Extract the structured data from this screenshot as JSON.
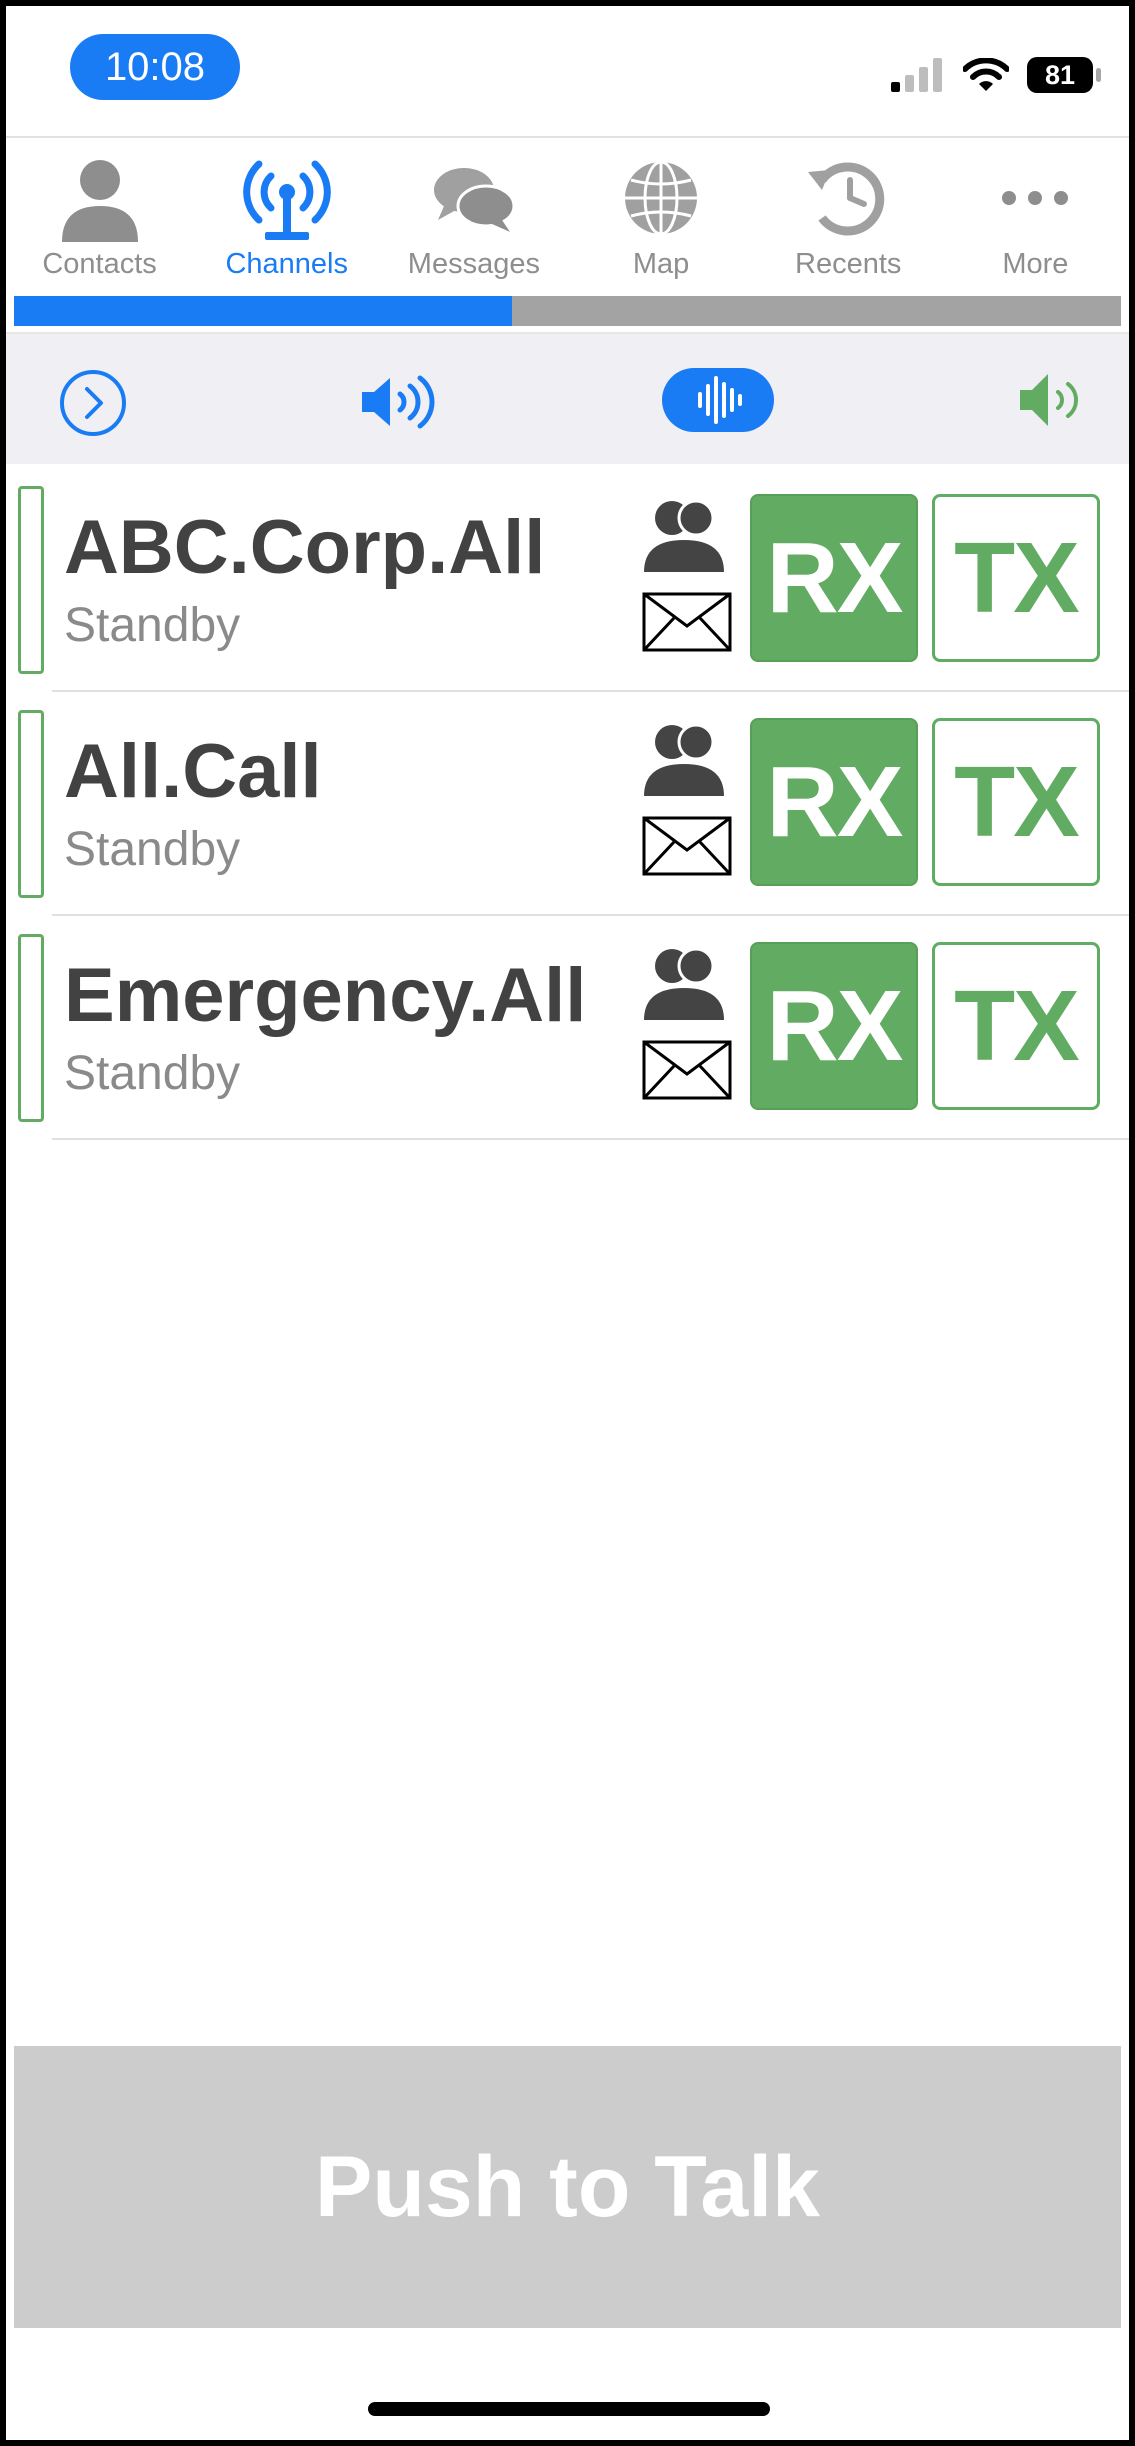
{
  "status_bar": {
    "time": "10:08",
    "battery": "81"
  },
  "colors": {
    "accent": "#1a7cf5",
    "inactive": "#8e8e8e",
    "green": "#62ab62",
    "ptt": "#cccccc"
  },
  "tabs": [
    {
      "label": "Contacts",
      "icon": "person-icon",
      "active": false
    },
    {
      "label": "Channels",
      "icon": "antenna-icon",
      "active": true
    },
    {
      "label": "Messages",
      "icon": "chat-bubbles-icon",
      "active": false
    },
    {
      "label": "Map",
      "icon": "globe-icon",
      "active": false
    },
    {
      "label": "Recents",
      "icon": "history-clock-icon",
      "active": false
    },
    {
      "label": "More",
      "icon": "ellipsis-icon",
      "active": false
    }
  ],
  "progress": {
    "fraction": 0.45
  },
  "toolbar": {
    "items": [
      "next-circle-icon",
      "speaker-icon",
      "waveform-icon",
      "speaker-green-icon"
    ]
  },
  "channels": [
    {
      "name": "ABC.Corp.All",
      "status": "Standby",
      "rx": "RX",
      "tx": "TX"
    },
    {
      "name": "All.Call",
      "status": "Standby",
      "rx": "RX",
      "tx": "TX"
    },
    {
      "name": "Emergency.All",
      "status": "Standby",
      "rx": "RX",
      "tx": "TX"
    }
  ],
  "push_to_talk": {
    "label": "Push to Talk"
  }
}
